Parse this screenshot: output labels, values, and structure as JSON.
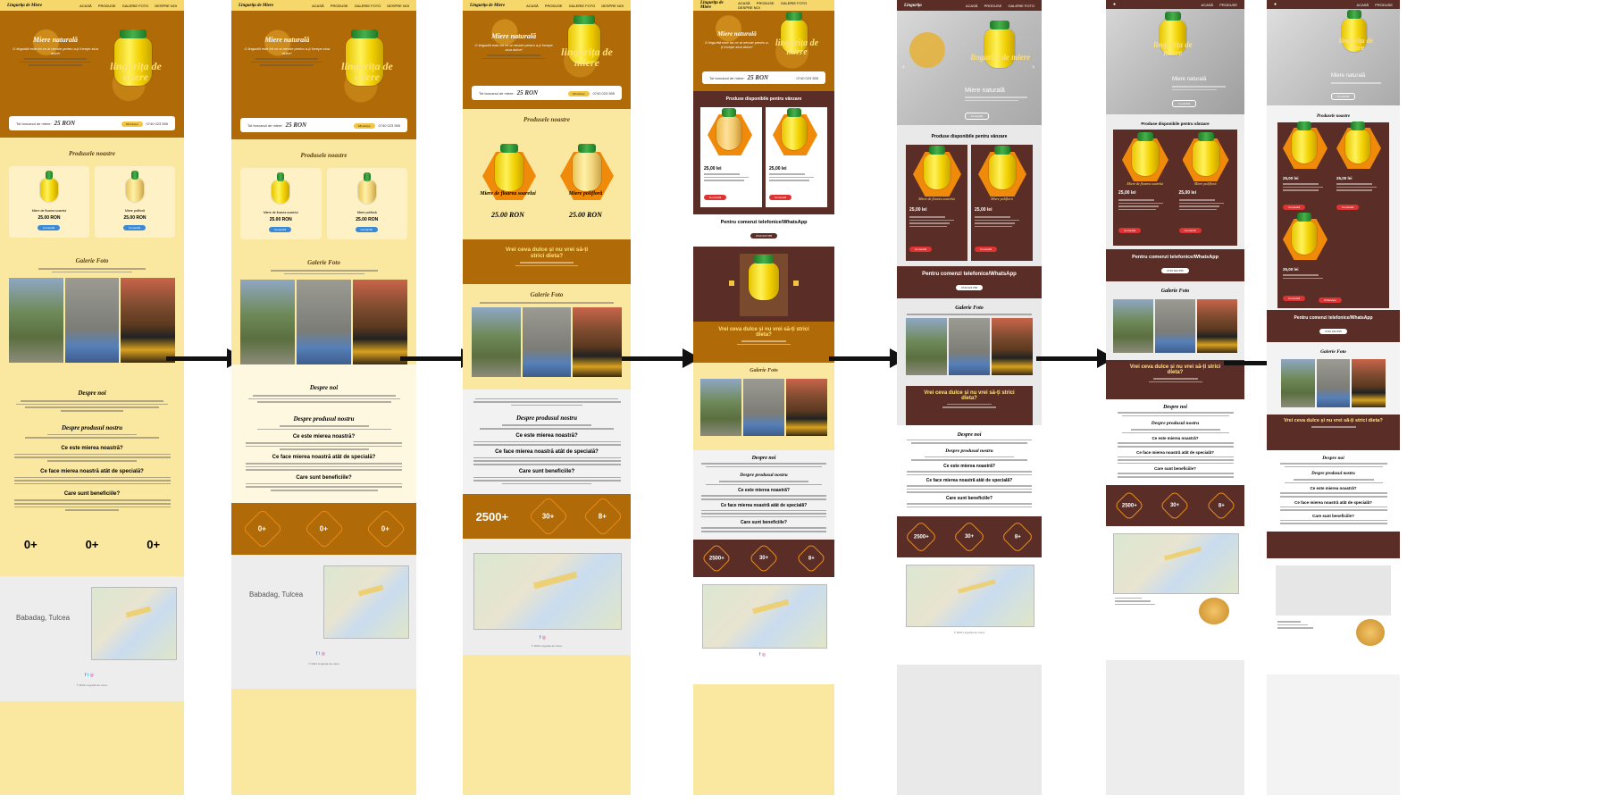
{
  "common": {
    "nav_links": [
      "ACASĂ",
      "PRODUSE",
      "GALERIE FOTO",
      "DESPRE NOI"
    ],
    "hero_title": "Miere naturală",
    "hero_subtitle": "O lingurită este tot ce ai nevoie pentru a-ți începe ziua dulce!",
    "brand_jar_text": "lingurița de miere",
    "price_label": "Tot borcanul de miere:",
    "price_value": "25 RON",
    "phone": "0740 023 555",
    "products_title": "Produsele noastre",
    "products_available_title": "Produse disponibile pentru vânzare",
    "product1": "Miere de floarea soarelui",
    "product2": "Miere polifloră",
    "product_price": "25.00 RON",
    "product_price_lei": "25,00 lei",
    "promo_title": "Vrei ceva dulce și nu vrei să-ți strici dieta?",
    "phone_orders": "Pentru comenzi telefonice/WhatsApp",
    "gallery_title": "Galerie Foto",
    "about_title": "Despre noi",
    "about_product_title": "Despre produsul nostru",
    "q1": "Ce este mierea noastră?",
    "q2": "Ce face mierea noastră atât de specială?",
    "q3": "Care sunt beneficiile?",
    "stats_zero": [
      "0+",
      "0+",
      "0+"
    ],
    "stats_final": [
      "2500+",
      "30+",
      "8+"
    ],
    "location": "Babadag, Tulcea",
    "footer_copy": "© 2024 Lingurița de miere"
  }
}
